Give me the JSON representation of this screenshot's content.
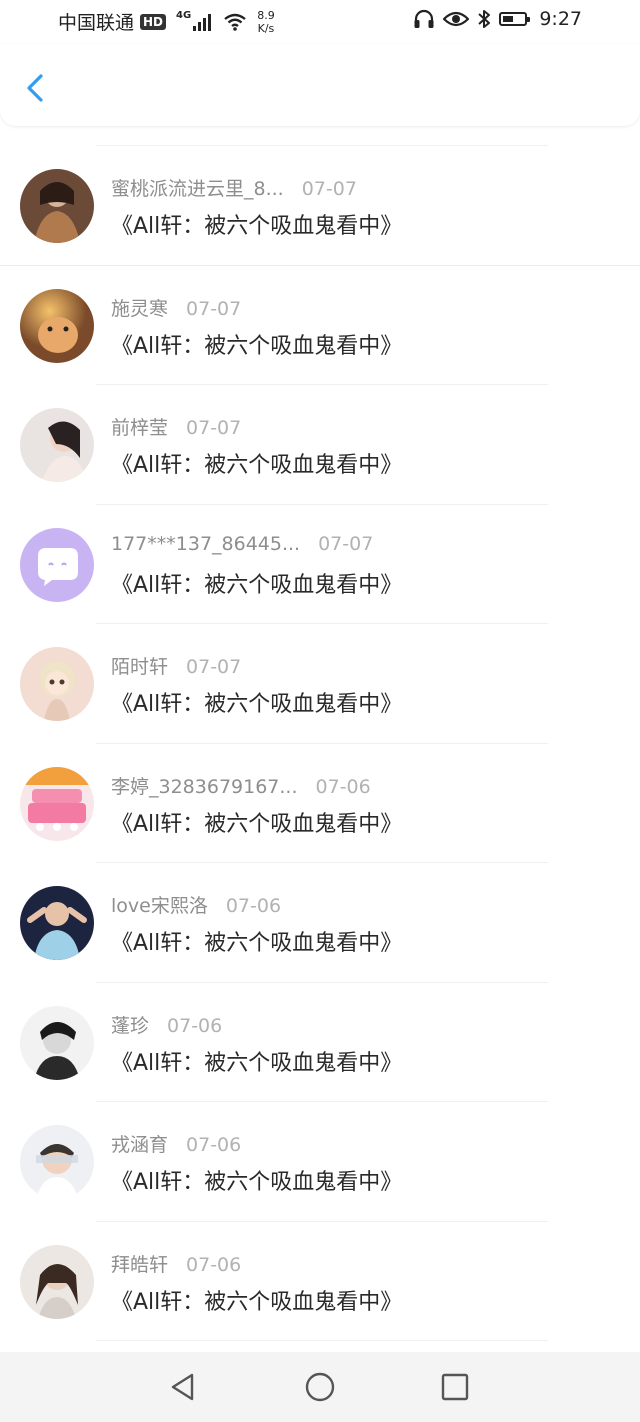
{
  "status_bar": {
    "carrier": "中国联通",
    "hd_badge": "HD",
    "network": "4G",
    "speed_value": "8.9",
    "speed_unit": "K/s",
    "battery_level": 0.5,
    "time": "9:27",
    "icons": [
      "signal-icon",
      "wifi-icon",
      "headphones-icon",
      "eye-icon",
      "bluetooth-icon",
      "battery-icon"
    ]
  },
  "header": {
    "back_icon": "chevron-left-icon",
    "accent_color": "#2f9ef2"
  },
  "messages": [
    {
      "name": "蜜桃派流进云里_8...",
      "date": "07-07",
      "title": "《All轩：被六个吸血鬼看中》",
      "avatar": "photo-avatar"
    },
    {
      "name": "施灵寒",
      "date": "07-07",
      "title": "《All轩：被六个吸血鬼看中》",
      "avatar": "photo-avatar"
    },
    {
      "name": "前梓莹",
      "date": "07-07",
      "title": "《All轩：被六个吸血鬼看中》",
      "avatar": "photo-avatar"
    },
    {
      "name": "177***137_86445...",
      "date": "07-07",
      "title": "《All轩：被六个吸血鬼看中》",
      "avatar": "chat-bubble-avatar"
    },
    {
      "name": "陌时轩",
      "date": "07-07",
      "title": "《All轩：被六个吸血鬼看中》",
      "avatar": "photo-avatar"
    },
    {
      "name": "李婷_3283679167...",
      "date": "07-06",
      "title": "《All轩：被六个吸血鬼看中》",
      "avatar": "cake-avatar"
    },
    {
      "name": "love宋熙洛",
      "date": "07-06",
      "title": "《All轩：被六个吸血鬼看中》",
      "avatar": "photo-avatar"
    },
    {
      "name": "蓬珍",
      "date": "07-06",
      "title": "《All轩：被六个吸血鬼看中》",
      "avatar": "photo-avatar"
    },
    {
      "name": "戎涵育",
      "date": "07-06",
      "title": "《All轩：被六个吸血鬼看中》",
      "avatar": "photo-avatar"
    },
    {
      "name": "拜皓轩",
      "date": "07-06",
      "title": "《All轩：被六个吸血鬼看中》",
      "avatar": "photo-avatar"
    }
  ],
  "nav_bar": {
    "buttons": [
      "back-triangle-icon",
      "home-circle-icon",
      "recents-square-icon"
    ]
  }
}
